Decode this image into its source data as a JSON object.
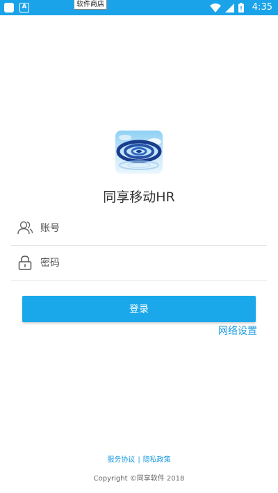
{
  "status_bar": {
    "store_tooltip": "软件商店",
    "time": "4:35",
    "icons": [
      "app-square-icon",
      "a-badge-icon",
      "wifi-icon",
      "signal-icon",
      "battery-icon"
    ]
  },
  "app": {
    "title": "同享移动HR",
    "logo": "app-logo"
  },
  "form": {
    "account_placeholder": "账号",
    "password_placeholder": "密码",
    "login_label": "登录",
    "network_settings": "网络设置"
  },
  "footer": {
    "service_agreement": "服务协议",
    "separator": "|",
    "privacy_policy": "隐私政策",
    "copyright": "Copyright ©同享软件 2018"
  },
  "colors": {
    "accent": "#1aa8ea",
    "status_bar": "#1aa3e8",
    "link": "#1a9be0"
  }
}
